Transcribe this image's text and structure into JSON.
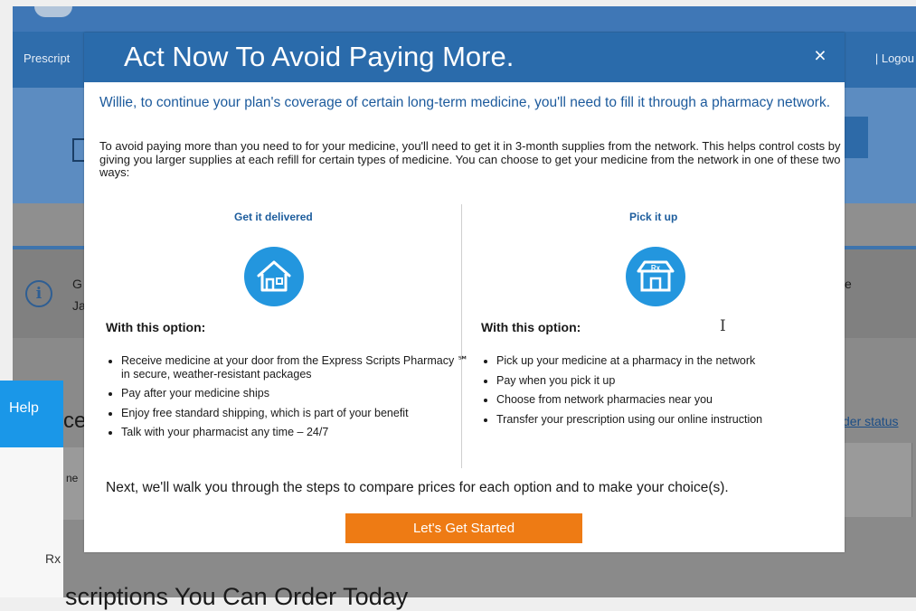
{
  "background": {
    "nav_left": "Prescript",
    "nav_right": "|  Logou",
    "info_line1_left": "G",
    "info_line2_left": "Ja",
    "info_right": "e",
    "help_label": "Help",
    "fragment_ce": "ce",
    "fragment_ne": "ne",
    "order_status": "der status",
    "rx_label": "Rx",
    "bottom_title": "scriptions You Can Order Today"
  },
  "modal": {
    "title": "Act Now To Avoid Paying More.",
    "close_symbol": "×",
    "intro": "Willie, to continue your plan's coverage of certain long-term medicine, you'll need to fill it through a pharmacy network.",
    "description": "To avoid paying more than you need to for your medicine, you'll need to get it in 3-month supplies from the network. This helps control costs by giving you larger supplies at each refill for certain types of medicine. You can choose to get your medicine from the network in one of these two ways:",
    "options": [
      {
        "title": "Get it delivered",
        "icon": "house-icon",
        "heading": "With this option:",
        "items": [
          "Receive medicine at your door from the Express Scripts Pharmacy ℠ in secure, weather-resistant packages",
          "Pay after your medicine ships",
          "Enjoy free standard shipping, which is part of your benefit",
          "Talk with your pharmacist any time – 24/7"
        ]
      },
      {
        "title": "Pick it up",
        "icon": "pharmacy-store-icon",
        "heading": "With this option:",
        "items": [
          "Pick up your medicine at a pharmacy in the network",
          "Pay when you pick it up",
          "Choose from network pharmacies near you",
          "Transfer your prescription using our online instruction"
        ]
      }
    ],
    "next_text": "Next, we'll walk you through the steps to compare prices for each option and to make your choice(s).",
    "cta_label": "Let's Get Started"
  },
  "colors": {
    "header_blue": "#2a6bab",
    "intro_blue": "#1c5a9c",
    "icon_blue": "#2396de",
    "cta_orange": "#ee7b14",
    "help_blue": "#1a97e8"
  }
}
